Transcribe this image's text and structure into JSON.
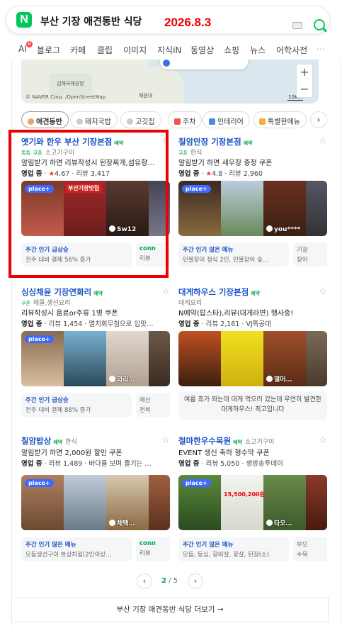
{
  "search": {
    "query": "부산 기장 애견동반 식당",
    "logo": "N"
  },
  "annotation": {
    "date": "2026.8.3"
  },
  "tabs": [
    "AI",
    "블로그",
    "카페",
    "클립",
    "이미지",
    "지식iN",
    "동영상",
    "쇼핑",
    "뉴스",
    "어학사전",
    "⋯"
  ],
  "map": {
    "credit": "© NAVER Corp. /OpenStreetMap",
    "scale": "10km",
    "labels": [
      "해운대",
      "김해국제공항"
    ],
    "zoom_in": "+",
    "zoom_out": "−"
  },
  "filters": [
    "애견동반",
    "돼지국밥",
    "고깃집",
    "주차",
    "인테리어",
    "특별한메뉴"
  ],
  "filter_next": "›",
  "cards": [
    {
      "name": "옛기와 한우 부산 기장본점",
      "badge": "예약",
      "tags": [
        "톡톡",
        "쿠폰"
      ],
      "category": "소고기구이",
      "desc": "알림받기 하면 리뷰작성시 된장찌개,섬유향…",
      "status": "영업 중",
      "rating": "4.67",
      "reviews": "리뷰 3,417",
      "photo_caption": "Sw12",
      "photo_banner": "부산기장맛집",
      "info_title": "주간 인기 급상승",
      "info_desc": "전주 대비 결제 56% 증가",
      "info2_title": "conn",
      "info2_desc": "리뷰"
    },
    {
      "name": "칠암만장 기장본점",
      "badge": "예약",
      "tags": [
        "쿠폰"
      ],
      "category": "한식",
      "desc": "알림받기 하면 새우장 증정 쿠폰",
      "status": "영업 중",
      "rating": "4.8",
      "reviews": "리뷰 2,960",
      "photo_caption": "you****",
      "info_title": "주간 인기 많은 메뉴",
      "info_desc": "민물장어 정식 2인, 민물장어 숯…",
      "info2_title": "기장",
      "info2_desc": "장어"
    },
    {
      "name": "싱싱채윤 기장연화리",
      "badge": "예약",
      "tags": [
        "쿠폰"
      ],
      "category": "해물,생선요리",
      "desc": "리뷰작성시 음료or주류 1병 쿠폰",
      "status": "영업 중",
      "reviews": "리뷰 1,454",
      "extra": "멸치회무침으로 입맛…",
      "photo_caption": "와리…",
      "info_title": "주간 인기 급상승",
      "info_desc": "전주 대비 결제 88% 증가",
      "info2_title": "해산",
      "info2_desc": "전복"
    },
    {
      "name": "대게하우스 기장본점",
      "badge": "예약",
      "tags": [],
      "category": "대게요리",
      "desc": "N예약(랍스타),리뷰(대게라면) 행사중!",
      "status": "영업 중",
      "reviews": "리뷰 2,161",
      "extra": "VJ특공대",
      "photo_caption": "멸머…",
      "quote": "여름 휴가 와는데 대게 먹으러 갔는데 우연히 발견한 대게하우스! 최고입니다"
    },
    {
      "name": "칠암밥상",
      "badge": "예약",
      "tags": [],
      "category": "한식",
      "desc": "알림받기 하면 2,000원 할인 쿠폰",
      "status": "영업 중",
      "reviews": "리뷰 1,489",
      "extra": "바다를 보며 즐기는 …",
      "photo_caption": "채택…",
      "info_title": "주간 인기 많은 메뉴",
      "info_desc": "모듬생선구이 한상차림(2인이상…",
      "info2_title": "conn",
      "info2_desc": "리뷰"
    },
    {
      "name": "철마한우수목원",
      "badge": "예약",
      "tags": [],
      "category": "소고기구이",
      "desc": "EVENT 생신 축하 형수막 쿠폰",
      "status": "영업 중",
      "reviews": "리뷰 5,050",
      "extra": "생방송투데이",
      "photo_caption": "타오…",
      "photo_banner": "15,500,200원",
      "info_title": "주간 인기 많은 메뉴",
      "info_desc": "모듬, 등심, 갈비살, 꽃살, 된장(소)",
      "info2_title": "부모",
      "info2_desc": "수목"
    }
  ],
  "place_plus": "place+",
  "pagination": {
    "current": "2",
    "sep": " / ",
    "total": "5",
    "prev": "‹",
    "next": "›"
  },
  "more_link": "부산 기장 애견동반 식당 더보기 →",
  "colors": {
    "naver_green": "#03c75a",
    "link_blue": "#1a53c6",
    "highlight_red": "#e00000"
  }
}
